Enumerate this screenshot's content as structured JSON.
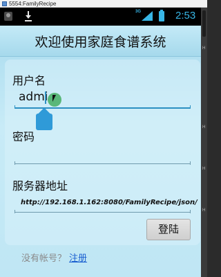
{
  "window": {
    "title": "5554:FamilyRecipe"
  },
  "statusbar": {
    "network": "3G",
    "time": "2:53"
  },
  "header": {
    "title": "欢迎使用家庭食谱系统"
  },
  "form": {
    "username_label": "用户名",
    "username_value": "admi",
    "password_label": "密码",
    "password_value": "",
    "server_label": "服务器地址",
    "server_value": "http://192.168.1.162:8080/FamilyRecipe/json/"
  },
  "actions": {
    "login_label": "登陆"
  },
  "register": {
    "prompt": "没有帐号？",
    "link_label": "注册"
  },
  "colors": {
    "accent": "#2c8fc2",
    "link": "#1a5fd0",
    "header_bg": "#a6d9ec",
    "status_accent": "#38b6e6"
  }
}
